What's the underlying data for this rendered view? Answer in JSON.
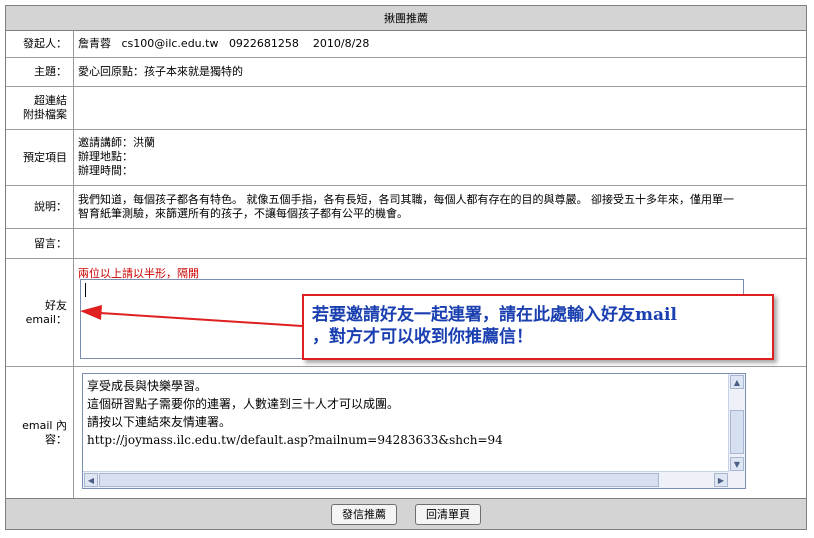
{
  "form": {
    "title": "揪團推薦",
    "rows": {
      "initiator": {
        "label": "發起人：",
        "value": "詹青蓉   cs100@ilc.edu.tw   0922681258    2010/8/28"
      },
      "subject": {
        "label": "主題：",
        "value": "愛心回原點：孩子本來就是獨特的"
      },
      "link": {
        "label_line1": "超連結",
        "label_line2": "附掛檔案"
      },
      "planned": {
        "label": "預定項目",
        "lines": [
          "邀請講師：洪蘭",
          "辦理地點：",
          "辦理時間："
        ]
      },
      "description": {
        "label": "說明：",
        "line1": "我們知道，每個孩子都各有特色。 就像五個手指，各有長短，各司其職，每個人都有存在的目的與尊嚴。 卻接受五十多年來，僅用單一",
        "line2": "智育紙筆測驗，來篩選所有的孩子，不讓每個孩子都有公平的機會。"
      },
      "comment": {
        "label": "留言："
      },
      "friend_email": {
        "label_line1": "好友",
        "label_line2": "email：",
        "hint": "兩位以上請以半形，隔開",
        "value": ""
      },
      "email_content": {
        "label_line1": "email 內",
        "label_line2": "容：",
        "lines": [
          "享受成長與快樂學習。",
          "這個研習點子需要你的連署，人數達到三十人才可以成團。",
          "請按以下連結來友情連署。",
          "http://joymass.ilc.edu.tw/default.asp?mailnum=94283633&shch=94"
        ]
      }
    },
    "buttons": {
      "send": "發信推薦",
      "reset": "回清單頁"
    }
  },
  "annotation": {
    "line1": "若要邀請好友一起連署，請在此處輸入好友mail",
    "line2": "，對方才可以收到你推薦信！",
    "color_border": "#e02020",
    "color_text": "#1a3fb0"
  }
}
